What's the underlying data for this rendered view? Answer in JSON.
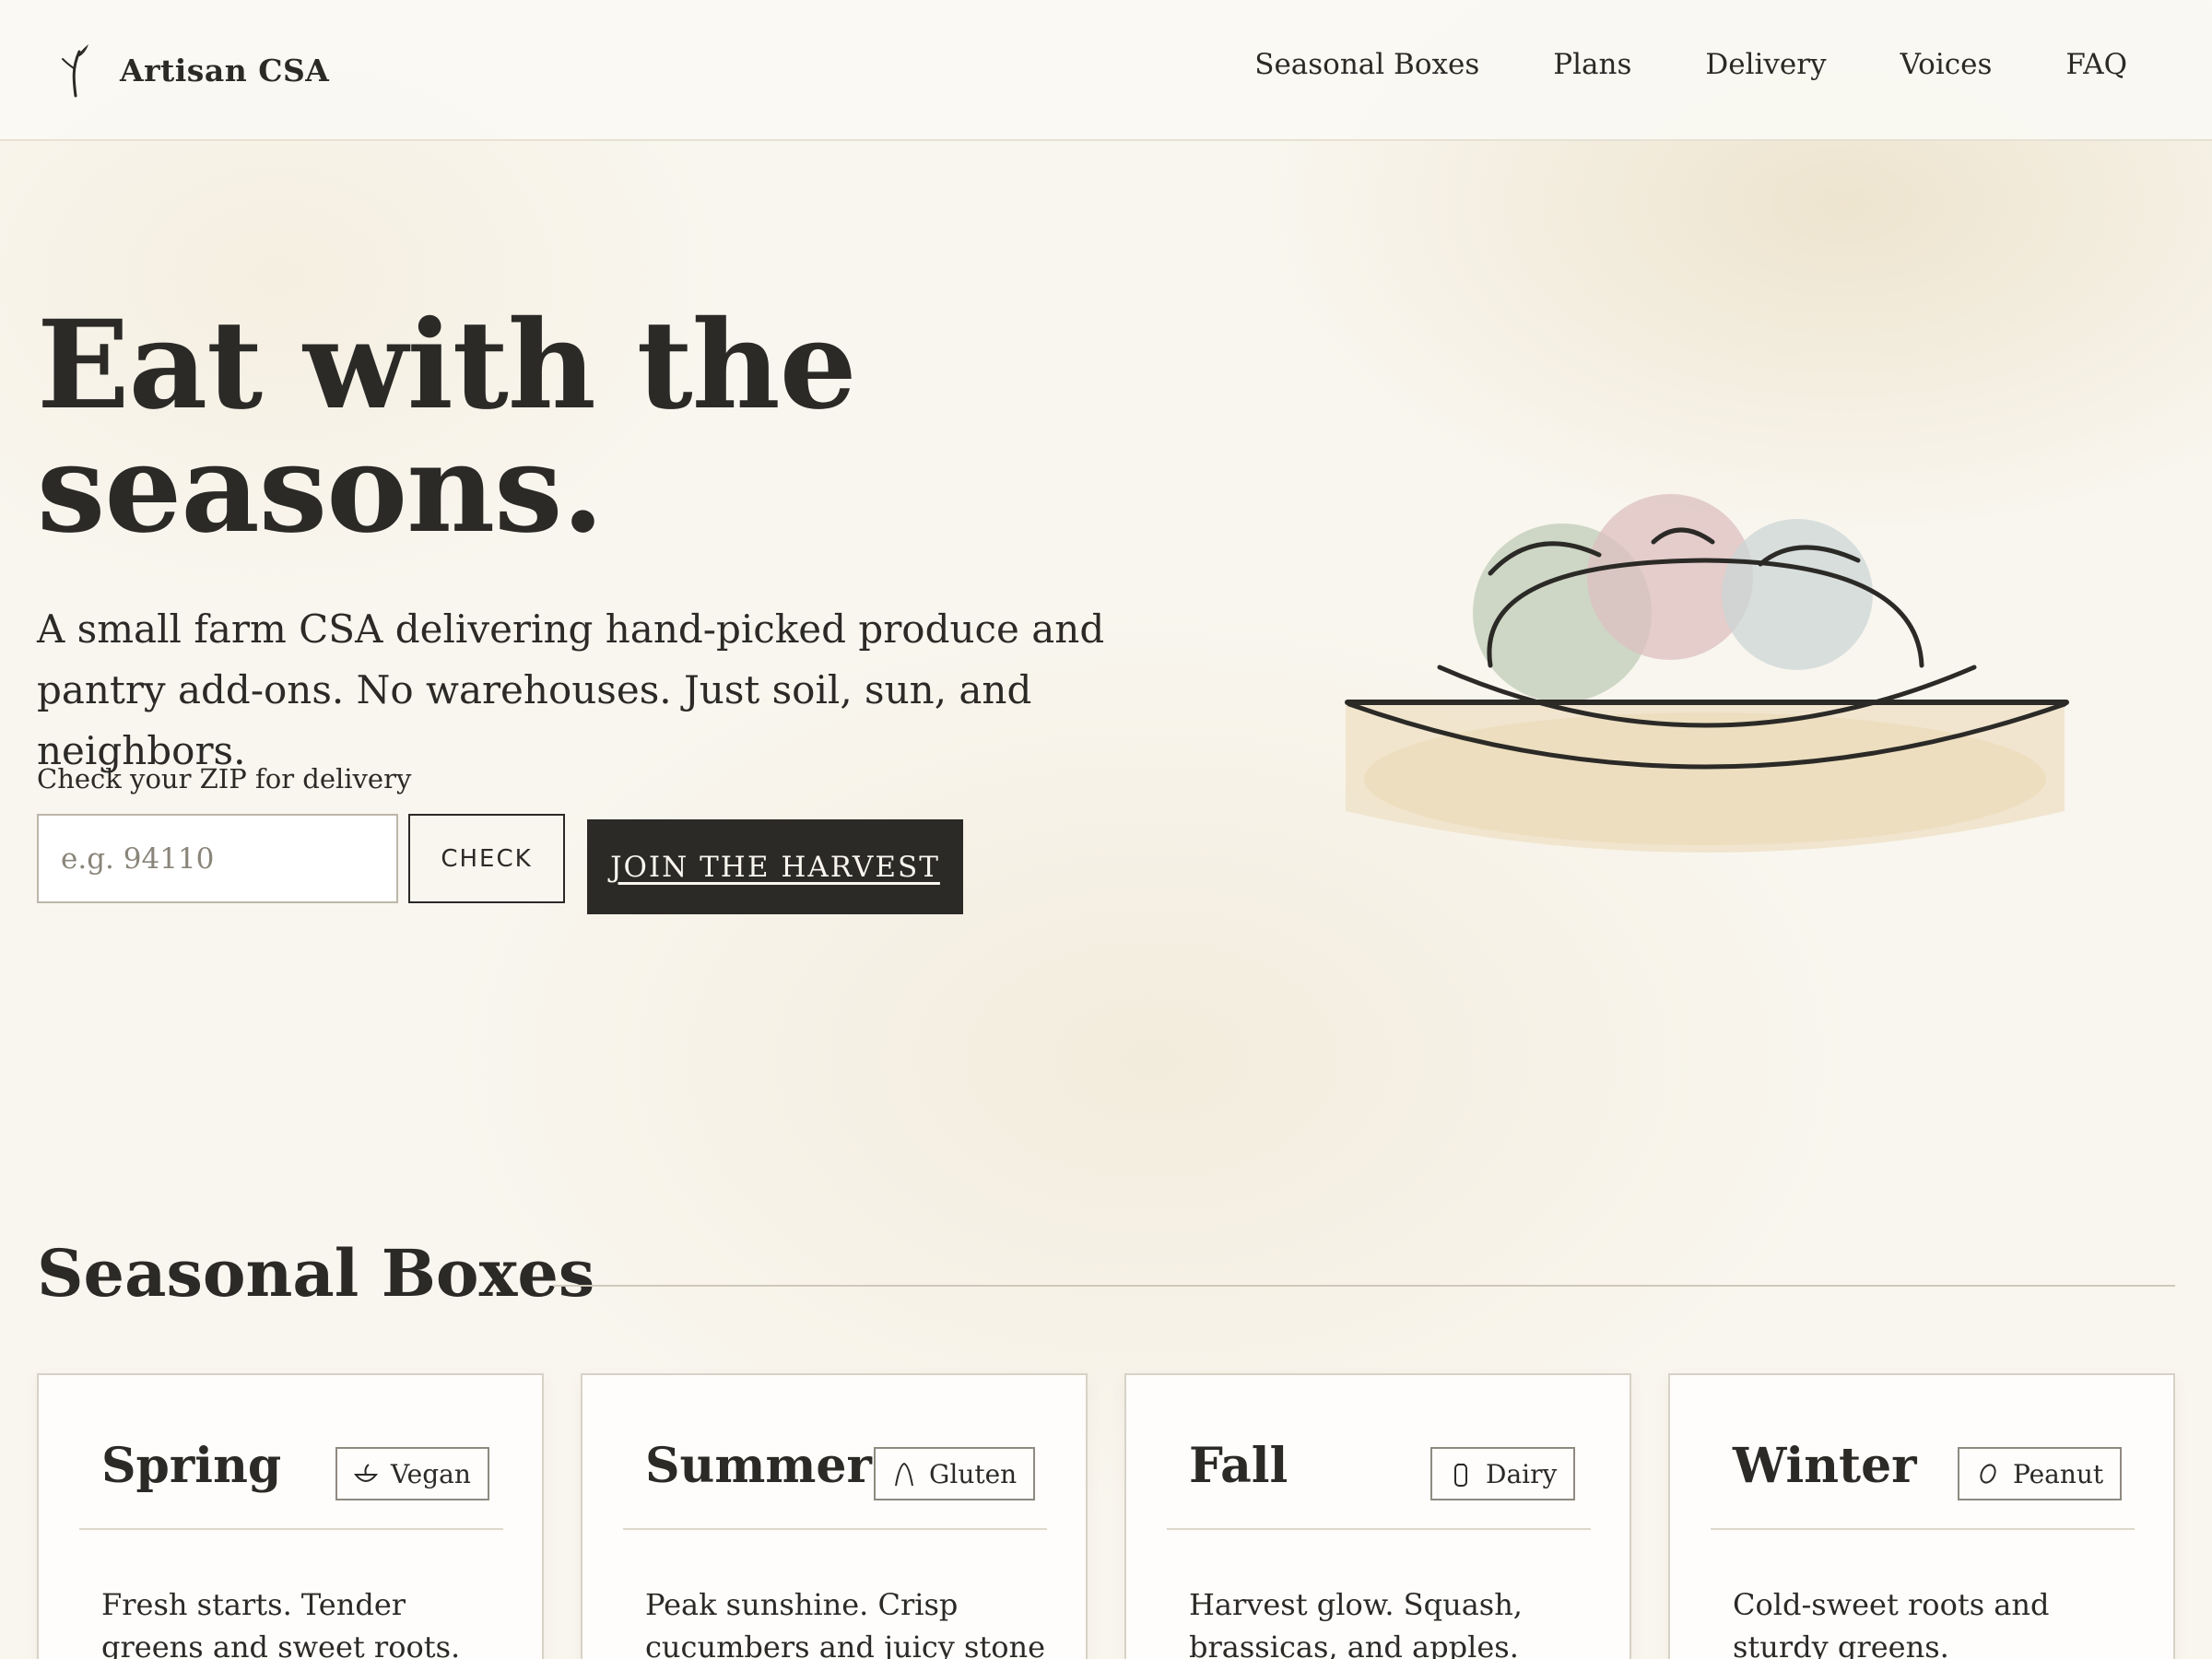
{
  "brand": {
    "name": "Artisan CSA",
    "icon": "sprout-icon"
  },
  "nav": [
    "Seasonal Boxes",
    "Plans",
    "Delivery",
    "Voices",
    "FAQ"
  ],
  "hero": {
    "title_line1": "Eat with the",
    "title_line2": "seasons.",
    "subtitle": "A small farm CSA delivering hand-picked produce and pantry add-ons. No warehouses. Just soil, sun, and neighbors.",
    "zip_label": "Check your ZIP for delivery",
    "zip_placeholder": "e.g. 94110",
    "zip_value": "",
    "check_label": "CHECK",
    "join_label": "JOIN THE HARVEST",
    "illustration": "produce-basket-illustration"
  },
  "seasonal": {
    "title": "Seasonal Boxes",
    "cards": [
      {
        "name": "Spring",
        "tag": "Vegan",
        "tag_icon": "leaf-icon",
        "desc": "Fresh starts. Tender greens and sweet roots."
      },
      {
        "name": "Summer",
        "tag": "Gluten",
        "tag_icon": "wheat-icon",
        "desc": "Peak sunshine. Crisp cucumbers and juicy stone"
      },
      {
        "name": "Fall",
        "tag": "Dairy",
        "tag_icon": "milk-bottle-icon",
        "desc": "Harvest glow. Squash, brassicas, and apples."
      },
      {
        "name": "Winter",
        "tag": "Peanut",
        "tag_icon": "peanut-icon",
        "desc": "Cold-sweet roots and sturdy greens."
      }
    ]
  },
  "colors": {
    "ink": "#2b2a27",
    "background": "#f9f6ef",
    "sage": "#c9d3c0",
    "rose": "#dcc4c4",
    "mist": "#d3dad9",
    "wheat": "#ecdcc0"
  }
}
